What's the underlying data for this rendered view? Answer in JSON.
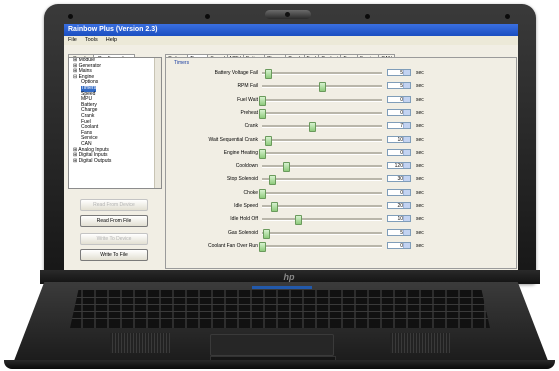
{
  "window": {
    "title": "Rainbow Plus (Version 2.3)"
  },
  "menu": [
    "File",
    "Tools",
    "Help"
  ],
  "left_tabs": [
    {
      "label": "Scada",
      "active": false
    },
    {
      "label": "Configuration",
      "active": true
    }
  ],
  "tree": [
    {
      "label": "Module",
      "indent": 1,
      "prefix": "⊞"
    },
    {
      "label": "Generator",
      "indent": 1,
      "prefix": "⊞"
    },
    {
      "label": "Mains",
      "indent": 1,
      "prefix": "⊞"
    },
    {
      "label": "Engine",
      "indent": 1,
      "prefix": "⊟"
    },
    {
      "label": "Options",
      "indent": 3,
      "prefix": ""
    },
    {
      "label": "Timers",
      "indent": 3,
      "prefix": "",
      "selected": true
    },
    {
      "label": "Speed",
      "indent": 3,
      "prefix": ""
    },
    {
      "label": "MPU",
      "indent": 3,
      "prefix": ""
    },
    {
      "label": "Battery",
      "indent": 3,
      "prefix": ""
    },
    {
      "label": "Charge",
      "indent": 3,
      "prefix": ""
    },
    {
      "label": "Crank",
      "indent": 3,
      "prefix": ""
    },
    {
      "label": "Fuel",
      "indent": 3,
      "prefix": ""
    },
    {
      "label": "Coolant",
      "indent": 3,
      "prefix": ""
    },
    {
      "label": "Fans",
      "indent": 3,
      "prefix": ""
    },
    {
      "label": "Service",
      "indent": 3,
      "prefix": ""
    },
    {
      "label": "CAN",
      "indent": 3,
      "prefix": ""
    },
    {
      "label": "Analog Inputs",
      "indent": 1,
      "prefix": "⊞"
    },
    {
      "label": "Digital Inputs",
      "indent": 1,
      "prefix": "⊞"
    },
    {
      "label": "Digital Outputs",
      "indent": 1,
      "prefix": "⊞"
    }
  ],
  "buttons": {
    "read_from_device": "Read From Device",
    "read_from_file": "Read From File",
    "write_to_device": "Write To Device",
    "write_to_file": "Write To File"
  },
  "right_tabs": [
    "Options",
    "Timers",
    "Speed",
    "MPU",
    "Battery",
    "Charge",
    "Crank",
    "Fuel",
    "Coolant",
    "Fans",
    "Service",
    "CAN"
  ],
  "active_right_tab": "Timers",
  "group_label": "Timers",
  "timers": [
    {
      "label": "Battery Voltage Fail",
      "value": "5",
      "unit": "sec",
      "level": 0.05
    },
    {
      "label": "RPM Fail",
      "value": "5",
      "unit": "sec",
      "level": 0.5
    },
    {
      "label": "Fuel Wait",
      "value": "0",
      "unit": "sec",
      "level": 0.0
    },
    {
      "label": "Preheat",
      "value": "0",
      "unit": "sec",
      "level": 0.0
    },
    {
      "label": "Crank",
      "value": "7",
      "unit": "sec",
      "level": 0.42
    },
    {
      "label": "Wait Sequential Crank",
      "value": "10",
      "unit": "sec",
      "level": 0.05
    },
    {
      "label": "Engine Heating",
      "value": "0",
      "unit": "sec",
      "level": 0.0
    },
    {
      "label": "Cooldown",
      "value": "120",
      "unit": "sec",
      "level": 0.2
    },
    {
      "label": "Stop Solenoid",
      "value": "30",
      "unit": "sec",
      "level": 0.08
    },
    {
      "label": "Choke",
      "value": "0",
      "unit": "sec",
      "level": 0.0
    },
    {
      "label": "Idle Speed",
      "value": "20",
      "unit": "sec",
      "level": 0.1
    },
    {
      "label": "Idle Hold Off",
      "value": "10",
      "unit": "sec",
      "level": 0.3
    },
    {
      "label": "Gas Solenoid",
      "value": "5",
      "unit": "sec",
      "level": 0.03
    },
    {
      "label": "Coolant Fan Over Run",
      "value": "0",
      "unit": "sec",
      "level": 0.0
    }
  ],
  "laptop_logo": "hp"
}
